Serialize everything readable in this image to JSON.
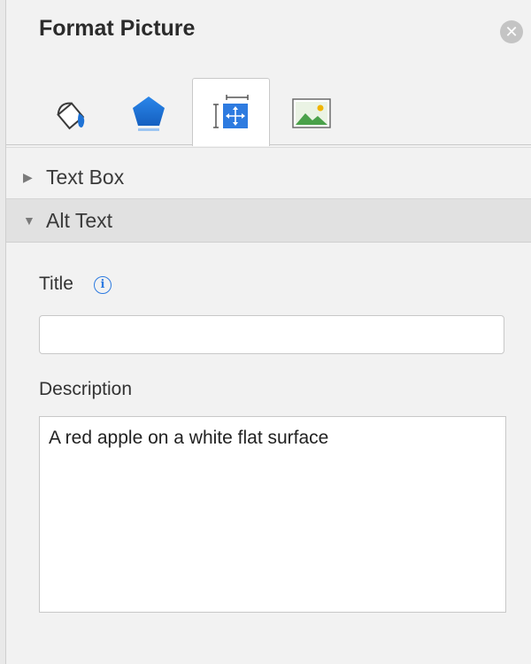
{
  "panel": {
    "title": "Format Picture",
    "close_icon": "close-icon"
  },
  "tabs": [
    {
      "name": "fill-line",
      "icon": "paint-bucket-icon",
      "selected": false
    },
    {
      "name": "effects",
      "icon": "pentagon-icon",
      "selected": false
    },
    {
      "name": "size-properties",
      "icon": "size-properties-icon",
      "selected": true
    },
    {
      "name": "picture",
      "icon": "picture-icon",
      "selected": false
    }
  ],
  "sections": {
    "text_box": {
      "label": "Text Box",
      "expanded": false
    },
    "alt_text": {
      "label": "Alt Text",
      "expanded": true
    }
  },
  "alt_text": {
    "title_label": "Title",
    "title_value": "",
    "description_label": "Description",
    "description_value": "A red apple on a white flat surface"
  },
  "colors": {
    "accent": "#2e7be0",
    "pentagon": "#1f73d6"
  }
}
